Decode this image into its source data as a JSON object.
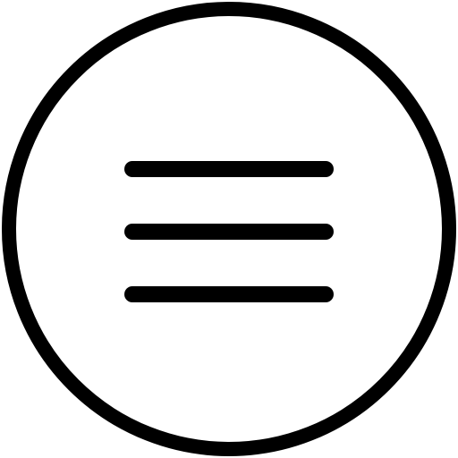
{
  "icon": {
    "name": "hamburger-menu-icon",
    "stroke_color": "#000000",
    "background_color": "#ffffff"
  }
}
